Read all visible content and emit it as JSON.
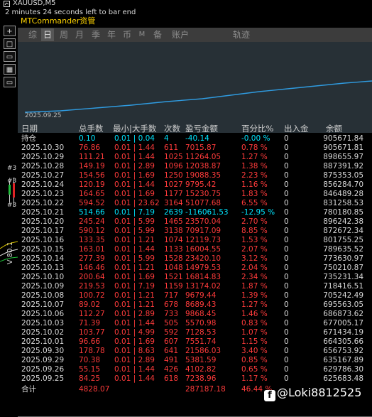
{
  "chart": {
    "symbol_title": "XAUUSD,M5",
    "bar_timer": "2 minutes 24 seconds left to bar end",
    "side_label": "V 80.1",
    "side_markers": [
      "#3",
      "#3",
      "#3"
    ]
  },
  "toolbar": {
    "buttons": [
      "+",
      "□",
      "▭",
      "▦",
      "▭"
    ]
  },
  "panel": {
    "title": "MTCommander资管",
    "tabs": [
      "综",
      "日",
      "周",
      "月",
      "季",
      "年",
      "币",
      "M",
      "备",
      "账户",
      "轨迹"
    ],
    "active_tab": "日",
    "equity_date": "2025.09.25"
  },
  "table": {
    "headers": [
      "日期",
      "总手数",
      "最小|大手数",
      "次数",
      "盈亏金额",
      "百分比%",
      "出入金",
      "余额"
    ],
    "holding": {
      "date": "持仓",
      "lots": "0.10",
      "range": "0.01 | 0.04",
      "count": "4",
      "profit": "-40.14",
      "pct": "-0.00 %",
      "deposit": "0",
      "balance": "905671.84"
    },
    "rows": [
      {
        "date": "2025.10.30",
        "lots": "76.86",
        "range": "0.01 | 1.44",
        "count": "611",
        "profit": "7015.87",
        "pct": "0.78 %",
        "deposit": "0",
        "balance": "905671.81",
        "sign": "pos"
      },
      {
        "date": "2025.10.29",
        "lots": "111.21",
        "range": "0.01 | 1.44",
        "count": "1025",
        "profit": "11264.05",
        "pct": "1.27 %",
        "deposit": "0",
        "balance": "898655.97",
        "sign": "pos"
      },
      {
        "date": "2025.10.28",
        "lots": "149.19",
        "range": "0.01 | 2.89",
        "count": "1096",
        "profit": "12038.87",
        "pct": "1.38 %",
        "deposit": "0",
        "balance": "887391.92",
        "sign": "pos"
      },
      {
        "date": "2025.10.27",
        "lots": "154.56",
        "range": "0.01 | 1.69",
        "count": "1250",
        "profit": "19088.35",
        "pct": "2.23 %",
        "deposit": "0",
        "balance": "875353.05",
        "sign": "pos"
      },
      {
        "date": "2025.10.24",
        "lots": "120.19",
        "range": "0.01 | 1.44",
        "count": "1027",
        "profit": "9795.42",
        "pct": "1.16 %",
        "deposit": "0",
        "balance": "856284.70",
        "sign": "pos"
      },
      {
        "date": "2025.10.23",
        "lots": "164.65",
        "range": "0.01 | 1.69",
        "count": "1177",
        "profit": "15230.75",
        "pct": "1.83 %",
        "deposit": "0",
        "balance": "846489.28",
        "sign": "pos"
      },
      {
        "date": "2025.10.22",
        "lots": "594.52",
        "range": "0.01 | 23.62",
        "count": "3164",
        "profit": "51077.68",
        "pct": "6.55 %",
        "deposit": "0",
        "balance": "831258.53",
        "sign": "pos"
      },
      {
        "date": "2025.10.21",
        "lots": "514.66",
        "range": "0.01 | 7.19",
        "count": "2639",
        "profit": "-116061.53",
        "pct": "-12.95 %",
        "deposit": "0",
        "balance": "780180.85",
        "sign": "neg"
      },
      {
        "date": "2025.10.20",
        "lots": "245.24",
        "range": "0.01 | 5.99",
        "count": "1465",
        "profit": "23570.04",
        "pct": "2.70 %",
        "deposit": "0",
        "balance": "896242.38",
        "sign": "pos"
      },
      {
        "date": "2025.10.17",
        "lots": "590.12",
        "range": "0.01 | 5.99",
        "count": "3138",
        "profit": "70917.09",
        "pct": "8.85 %",
        "deposit": "0",
        "balance": "872672.34",
        "sign": "pos"
      },
      {
        "date": "2025.10.16",
        "lots": "133.35",
        "range": "0.01 | 1.21",
        "count": "1074",
        "profit": "12119.73",
        "pct": "1.53 %",
        "deposit": "0",
        "balance": "801755.25",
        "sign": "pos"
      },
      {
        "date": "2025.10.15",
        "lots": "163.01",
        "range": "0.01 | 1.44",
        "count": "1133",
        "profit": "16004.55",
        "pct": "2.07 %",
        "deposit": "0",
        "balance": "789635.52",
        "sign": "pos"
      },
      {
        "date": "2025.10.14",
        "lots": "277.39",
        "range": "0.01 | 5.99",
        "count": "1528",
        "profit": "23420.10",
        "pct": "3.12 %",
        "deposit": "0",
        "balance": "773630.97",
        "sign": "pos"
      },
      {
        "date": "2025.10.13",
        "lots": "146.46",
        "range": "0.01 | 1.21",
        "count": "1048",
        "profit": "14979.53",
        "pct": "2.04 %",
        "deposit": "0",
        "balance": "750210.87",
        "sign": "pos"
      },
      {
        "date": "2025.10.10",
        "lots": "200.64",
        "range": "0.01 | 1.69",
        "count": "1521",
        "profit": "16814.83",
        "pct": "2.34 %",
        "deposit": "0",
        "balance": "735231.34",
        "sign": "pos"
      },
      {
        "date": "2025.10.09",
        "lots": "219.53",
        "range": "0.01 | 7.19",
        "count": "1159",
        "profit": "13174.02",
        "pct": "1.87 %",
        "deposit": "0",
        "balance": "718416.51",
        "sign": "pos"
      },
      {
        "date": "2025.10.08",
        "lots": "100.72",
        "range": "0.01 | 1.21",
        "count": "717",
        "profit": "9679.44",
        "pct": "1.39 %",
        "deposit": "0",
        "balance": "705242.49",
        "sign": "pos"
      },
      {
        "date": "2025.10.07",
        "lots": "89.02",
        "range": "0.01 | 1.21",
        "count": "678",
        "profit": "8689.43",
        "pct": "1.27 %",
        "deposit": "0",
        "balance": "695563.05",
        "sign": "pos"
      },
      {
        "date": "2025.10.06",
        "lots": "112.27",
        "range": "0.01 | 2.89",
        "count": "733",
        "profit": "9868.45",
        "pct": "1.46 %",
        "deposit": "0",
        "balance": "686873.62",
        "sign": "pos"
      },
      {
        "date": "2025.10.03",
        "lots": "71.39",
        "range": "0.01 | 1.44",
        "count": "505",
        "profit": "5570.98",
        "pct": "0.83 %",
        "deposit": "0",
        "balance": "677005.17",
        "sign": "pos"
      },
      {
        "date": "2025.10.02",
        "lots": "103.77",
        "range": "0.01 | 4.99",
        "count": "592",
        "profit": "7128.53",
        "pct": "1.07 %",
        "deposit": "0",
        "balance": "671434.19",
        "sign": "pos"
      },
      {
        "date": "2025.10.01",
        "lots": "96.66",
        "range": "0.01 | 1.69",
        "count": "607",
        "profit": "7551.74",
        "pct": "1.15 %",
        "deposit": "0",
        "balance": "664305.66",
        "sign": "pos"
      },
      {
        "date": "2025.09.30",
        "lots": "178.78",
        "range": "0.01 | 8.63",
        "count": "641",
        "profit": "21586.03",
        "pct": "3.40 %",
        "deposit": "0",
        "balance": "656753.92",
        "sign": "pos"
      },
      {
        "date": "2025.09.29",
        "lots": "70.38",
        "range": "0.01 | 2.89",
        "count": "491",
        "profit": "5381.59",
        "pct": "0.85 %",
        "deposit": "0",
        "balance": "635167.89",
        "sign": "pos"
      },
      {
        "date": "2025.09.26",
        "lots": "55.15",
        "range": "0.01 | 1.44",
        "count": "426",
        "profit": "4102.82",
        "pct": "0.65 %",
        "deposit": "0",
        "balance": "629786.30",
        "sign": "pos"
      },
      {
        "date": "2025.09.25",
        "lots": "84.25",
        "range": "0.01 | 1.44",
        "count": "618",
        "profit": "7238.96",
        "pct": "1.17 %",
        "deposit": "0",
        "balance": "625683.48",
        "sign": "pos"
      }
    ],
    "total": {
      "label": "合计",
      "lots": "4828.07",
      "profit": "287187.18",
      "pct": "46.44 %"
    }
  },
  "watermark": {
    "text": "@Loki8812525"
  },
  "colors": {
    "positive": "#ff3b3b",
    "negative": "#00e5ff",
    "title": "#ffd400",
    "equity_line": "#2f9be0",
    "equity_bg": "#273036"
  }
}
